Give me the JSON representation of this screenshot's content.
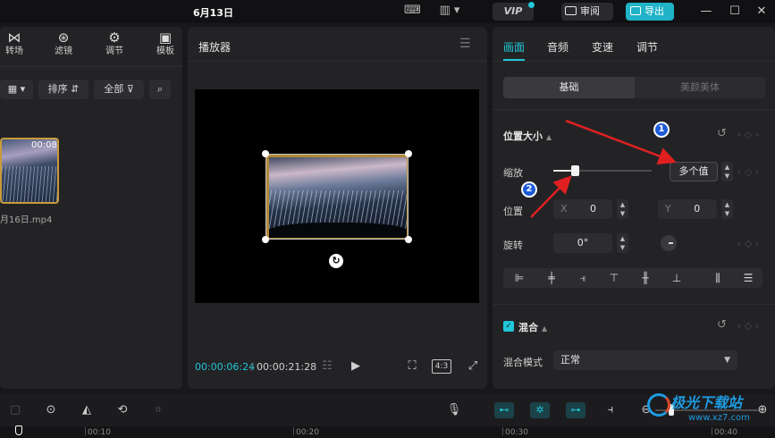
{
  "titlebar": {
    "title": "6月13日",
    "vip_label": "VIP",
    "review_label": "审阅",
    "export_label": "导出"
  },
  "left_panel": {
    "tabs": [
      {
        "label": "转场",
        "glyph": "⋈"
      },
      {
        "label": "滤镜",
        "glyph": "⊛"
      },
      {
        "label": "调节",
        "glyph": "⚙"
      },
      {
        "label": "模板",
        "glyph": "▣"
      }
    ],
    "sort_label": "排序",
    "filter_label": "全部",
    "clip": {
      "duration": "00:08",
      "name": "月16日.mp4"
    }
  },
  "player": {
    "title": "播放器",
    "current_time": "00:00:06:24",
    "total_time": "00:00:21:28",
    "ratio_label": "4:3"
  },
  "inspector": {
    "tabs": [
      "画面",
      "音频",
      "变速",
      "调节"
    ],
    "active_tab": "画面",
    "segments": [
      "基础",
      "美颜美体"
    ],
    "position_size": {
      "title": "位置大小",
      "scale_label": "缩放",
      "scale_value": "多个值",
      "scale_level": 0.22,
      "position_label": "位置",
      "x_label": "X",
      "x_value": "0",
      "y_label": "Y",
      "y_value": "0",
      "rotate_label": "旋转",
      "rotate_value": "0°"
    },
    "blend": {
      "title": "混合",
      "mode_label": "混合模式",
      "mode_value": "正常",
      "enabled": true
    }
  },
  "annotations": {
    "badge1": "1",
    "badge2": "2",
    "arrow_color": "#e02020"
  },
  "timeline": {
    "ruler_labels": [
      "00:10",
      "00:20",
      "00:30",
      "00:40"
    ]
  },
  "watermark": {
    "title": "极光下载站",
    "url": "www.xz7.com"
  },
  "colors": {
    "accent": "#21c6d8",
    "export": "#20b3c7",
    "background": "#18181b",
    "panel": "#232326"
  }
}
